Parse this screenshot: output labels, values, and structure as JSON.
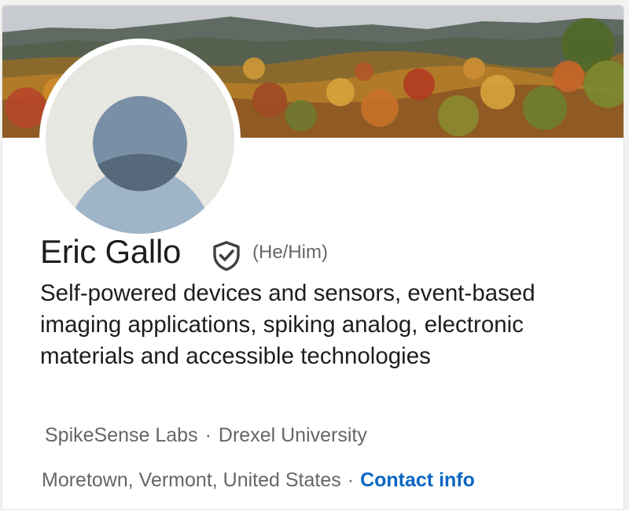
{
  "profile": {
    "name": "Eric Gallo",
    "pronouns": "(He/Him)",
    "verified_icon": "verified-shield-icon",
    "headline": "Self-powered devices and sensors, event-based imaging applications, spiking analog, electronic materials and accessible technologies",
    "orgs": {
      "company": "SpikeSense Labs",
      "separator": "·",
      "education": "Drexel University"
    },
    "location": "Moretown, Vermont, United States",
    "location_separator": "·",
    "contact_label": "Contact info"
  },
  "colors": {
    "link": "#0a66c2",
    "text_primary": "#1d1d1d",
    "text_secondary": "#666666",
    "avatar_bg": "#e8e6e1",
    "avatar_figure": "#a0b4c8"
  }
}
